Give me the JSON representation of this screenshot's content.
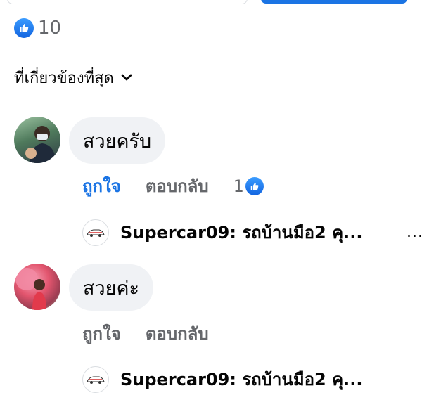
{
  "summary": {
    "like_count": "10"
  },
  "sort": {
    "label": "ที่เกี่ยวข้องที่สุด"
  },
  "comments": [
    {
      "text": "สวยครับ",
      "like_label": "ถูกใจ",
      "liked": true,
      "reply_label": "ตอบกลับ",
      "reaction_count": "1",
      "reply_preview": "Supercar09: รถบ้านมือ2 คุ..."
    },
    {
      "text": "สวยค่ะ",
      "like_label": "ถูกใจ",
      "liked": false,
      "reply_label": "ตอบกลับ",
      "reply_preview": "Supercar09: รถบ้านมือ2 คุ..."
    }
  ],
  "more": {
    "label": "..."
  },
  "colors": {
    "accent": "#1b74e4",
    "muted": "#65676b",
    "bubble": "#f0f2f5"
  }
}
